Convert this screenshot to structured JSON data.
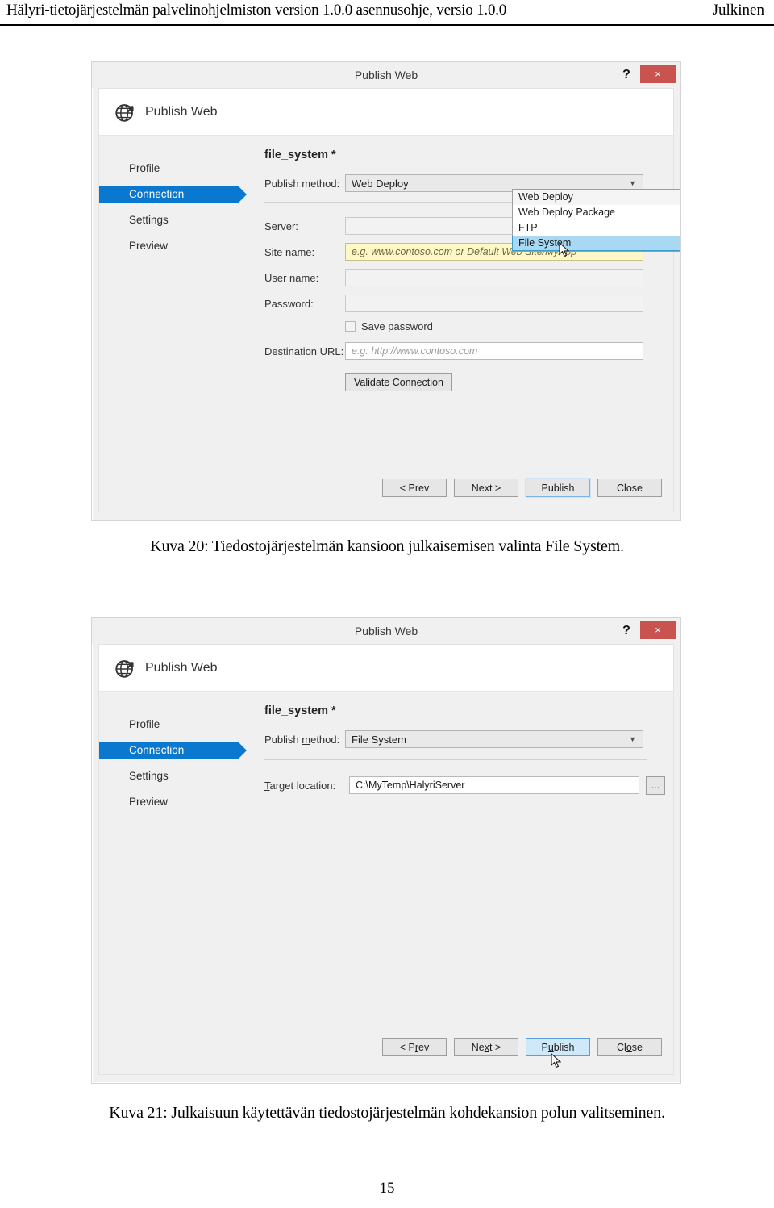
{
  "document": {
    "header_left": "Hälyri-tietojärjestelmän palvelinohjelmiston version 1.0.0 asennusohje, versio 1.0.0",
    "header_right": "Julkinen",
    "page_number": "15",
    "caption_20": "Kuva 20: Tiedostojärjestelmän kansioon julkaisemisen valinta File System.",
    "caption_21": "Kuva 21: Julkaisuun käytettävän tiedostojärjestelmän kohdekansion polun valitseminen."
  },
  "colors": {
    "nav_selected": "#0b78d0",
    "close_button": "#c9534f",
    "dropdown_highlight": "#a9d9f2",
    "warn_field": "#fdf8c4",
    "hover_button": "#cfe9f9"
  },
  "dialog1": {
    "title": "Publish Web",
    "help_label": "?",
    "close_label": "×",
    "banner_label": "Publish Web",
    "banner_icon": "globe-publish-icon",
    "nav": [
      {
        "label": "Profile",
        "selected": false
      },
      {
        "label": "Connection",
        "selected": true
      },
      {
        "label": "Settings",
        "selected": false
      },
      {
        "label": "Preview",
        "selected": false
      }
    ],
    "profile_name": "file_system *",
    "publish_method_label": "Publish method:",
    "publish_method_value": "Web Deploy",
    "dropdown_open": true,
    "dropdown_options": [
      "Web Deploy",
      "Web Deploy Package",
      "FTP",
      "File System"
    ],
    "dropdown_selected": "File System",
    "server_label": "Server:",
    "site_name_label": "Site name:",
    "site_name_placeholder": "e.g. www.contoso.com or Default Web Site/MyApp",
    "user_name_label": "User name:",
    "user_name_value": "",
    "password_label": "Password:",
    "password_value": "",
    "save_password_label": "Save password",
    "save_password_checked": false,
    "destination_url_label": "Destination URL:",
    "destination_url_placeholder": "e.g. http://www.contoso.com",
    "validate_label": "Validate Connection",
    "buttons": [
      {
        "label": "< Prev",
        "state": "normal"
      },
      {
        "label": "Next >",
        "state": "normal"
      },
      {
        "label": "Publish",
        "state": "focused"
      },
      {
        "label": "Close",
        "state": "normal"
      }
    ]
  },
  "dialog2": {
    "title": "Publish Web",
    "help_label": "?",
    "close_label": "×",
    "banner_label": "Publish Web",
    "banner_icon": "globe-publish-icon",
    "nav": [
      {
        "label": "Profile",
        "selected": false
      },
      {
        "label": "Connection",
        "selected": true
      },
      {
        "label": "Settings",
        "selected": false
      },
      {
        "label": "Preview",
        "selected": false
      }
    ],
    "profile_name": "file_system *",
    "publish_method_label_pre": "Publish ",
    "publish_method_label_key": "m",
    "publish_method_label_post": "ethod:",
    "publish_method_value": "File System",
    "target_location_label_key": "T",
    "target_location_label_post": "arget location:",
    "target_location_value": "C:\\MyTemp\\HalyriServer",
    "browse_label": "...",
    "buttons": [
      {
        "label_pre": "< P",
        "key": "r",
        "label_post": "ev",
        "state": "normal"
      },
      {
        "label_pre": "Ne",
        "key": "x",
        "label_post": "t >",
        "state": "normal"
      },
      {
        "label_pre": "P",
        "key": "u",
        "label_post": "blish",
        "state": "hovered"
      },
      {
        "label_pre": "Cl",
        "key": "o",
        "label_post": "se",
        "state": "normal"
      }
    ]
  }
}
